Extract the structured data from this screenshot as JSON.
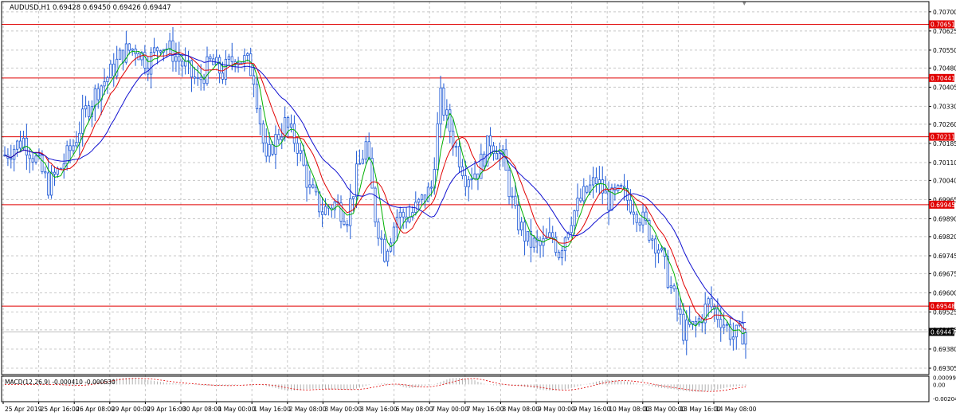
{
  "window": {
    "symbol_line": "AUDUSD,H1  0.69428 0.69450 0.69426 0.69447"
  },
  "colors": {
    "background": "#ffffff",
    "grid": "#c8c8c8",
    "candles": "#1f5ad6",
    "ma_fast": "#00b000",
    "ma_mid": "#e00000",
    "ma_slow": "#1010d0",
    "level_line": "#e00000",
    "level_label_bg": "#e00000",
    "price_label_bg": "#000000",
    "macd_hist": "#b0b0b0",
    "macd_signal": "#e00000"
  },
  "chart_data": {
    "type": "candlestick",
    "instrument": "AUDUSD",
    "timeframe": "H1",
    "y_ticks": [
      "0.70700",
      "0.70625",
      "0.70550",
      "0.70480",
      "0.70405",
      "0.70330",
      "0.70260",
      "0.70185",
      "0.70110",
      "0.70040",
      "0.69965",
      "0.69890",
      "0.69820",
      "0.69745",
      "0.69675",
      "0.69600",
      "0.69525",
      "0.69455",
      "0.69380",
      "0.69305"
    ],
    "ylim": [
      0.6928,
      0.7074
    ],
    "x_ticks": [
      "25 Apr 2019",
      "25 Apr 16:00",
      "26 Apr 08:00",
      "29 Apr 00:00",
      "29 Apr 16:00",
      "30 Apr 08:00",
      "1 May 00:00",
      "1 May 16:00",
      "2 May 08:00",
      "3 May 00:00",
      "3 May 16:00",
      "6 May 08:00",
      "7 May 00:00",
      "7 May 16:00",
      "8 May 08:00",
      "9 May 00:00",
      "9 May 16:00",
      "10 May 08:00",
      "13 May 00:00",
      "13 May 16:00",
      "14 May 08:00"
    ],
    "levels": [
      {
        "value": 0.70651,
        "label": "0.70651"
      },
      {
        "value": 0.70441,
        "label": "0.70441"
      },
      {
        "value": 0.70211,
        "label": "0.70211"
      },
      {
        "value": 0.69945,
        "label": "0.69945"
      },
      {
        "value": 0.69548,
        "label": "0.69548"
      }
    ],
    "current_price": {
      "value": 0.69447,
      "label": "0.69447"
    },
    "price_path": [
      [
        0,
        0.7014
      ],
      [
        6,
        0.702
      ],
      [
        10,
        0.7012
      ],
      [
        14,
        0.7002
      ],
      [
        18,
        0.7009
      ],
      [
        22,
        0.7018
      ],
      [
        26,
        0.7031
      ],
      [
        30,
        0.704
      ],
      [
        34,
        0.7046
      ],
      [
        38,
        0.7054
      ],
      [
        42,
        0.7056
      ],
      [
        46,
        0.705
      ],
      [
        50,
        0.7058
      ],
      [
        54,
        0.7054
      ],
      [
        58,
        0.7048
      ],
      [
        62,
        0.7042
      ],
      [
        66,
        0.705
      ],
      [
        70,
        0.7046
      ],
      [
        74,
        0.7053
      ],
      [
        78,
        0.705
      ],
      [
        80,
        0.7045
      ],
      [
        84,
        0.701
      ],
      [
        86,
        0.7018
      ],
      [
        90,
        0.7026
      ],
      [
        94,
        0.7018
      ],
      [
        98,
        0.7
      ],
      [
        102,
        0.6992
      ],
      [
        106,
        0.6995
      ],
      [
        110,
        0.699
      ],
      [
        113,
        0.7006
      ],
      [
        116,
        0.7018
      ],
      [
        119,
        0.699
      ],
      [
        122,
        0.6976
      ],
      [
        126,
        0.699
      ],
      [
        130,
        0.699
      ],
      [
        134,
        0.6996
      ],
      [
        137,
        0.7001
      ],
      [
        140,
        0.7036
      ],
      [
        144,
        0.702
      ],
      [
        148,
        0.7006
      ],
      [
        152,
        0.7008
      ],
      [
        156,
        0.702
      ],
      [
        160,
        0.7012
      ],
      [
        164,
        0.699
      ],
      [
        168,
        0.698
      ],
      [
        172,
        0.6978
      ],
      [
        176,
        0.6982
      ],
      [
        178,
        0.6976
      ],
      [
        182,
        0.699
      ],
      [
        186,
        0.6998
      ],
      [
        190,
        0.7004
      ],
      [
        194,
        0.6996
      ],
      [
        198,
        0.6999
      ],
      [
        202,
        0.6994
      ],
      [
        206,
        0.6986
      ],
      [
        210,
        0.6978
      ],
      [
        214,
        0.6962
      ],
      [
        218,
        0.6945
      ],
      [
        222,
        0.6947
      ],
      [
        226,
        0.6956
      ],
      [
        230,
        0.695
      ],
      [
        234,
        0.6943
      ],
      [
        238,
        0.69447
      ]
    ],
    "indicator": {
      "label": "MACD(12,26,9) -0.000410 -0.000530",
      "y_ticks": [
        "0.000998",
        "0.00",
        "-0.002047"
      ],
      "ylim": [
        -0.0025,
        0.0012
      ]
    }
  }
}
